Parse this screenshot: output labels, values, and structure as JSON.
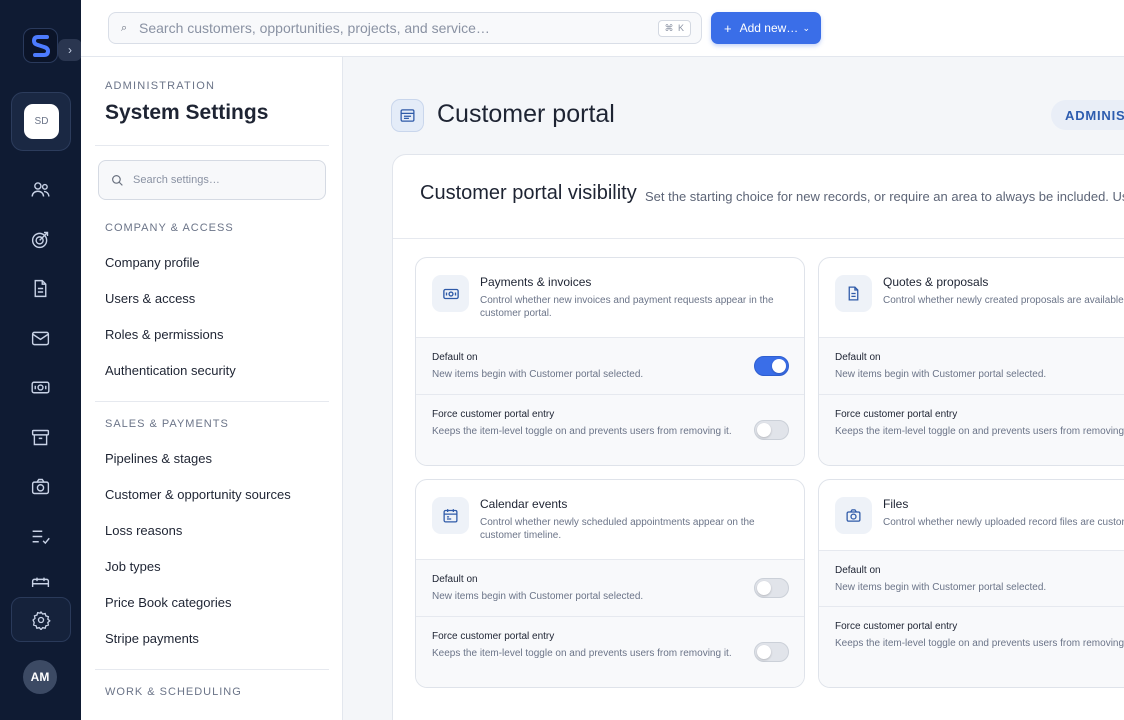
{
  "sidebar": {
    "logo_letter": "S",
    "workspace_initials": "SD",
    "user_initials": "AM",
    "nav_icons": [
      "people-icon",
      "target-icon",
      "document-icon",
      "mail-icon",
      "money-icon",
      "archive-icon",
      "camera-icon",
      "checklist-icon",
      "calendar-icon"
    ],
    "expand_label": "›"
  },
  "topbar": {
    "search_placeholder": "Search customers, opportunities, projects, and service…",
    "shortcut": "⌘ K",
    "add_label": "Add new…"
  },
  "settings": {
    "eyebrow": "ADMINISTRATION",
    "title": "System Settings",
    "search_placeholder": "Search settings…",
    "sections": [
      {
        "title": "COMPANY & ACCESS",
        "items": [
          "Company profile",
          "Users & access",
          "Roles & permissions",
          "Authentication security"
        ]
      },
      {
        "title": "SALES & PAYMENTS",
        "items": [
          "Pipelines & stages",
          "Customer & opportunity sources",
          "Loss reasons",
          "Job types",
          "Price Book categories",
          "Stripe payments"
        ]
      },
      {
        "title": "WORK & SCHEDULING",
        "items": []
      }
    ]
  },
  "page": {
    "title": "Customer portal",
    "badge": "ADMINIST",
    "panel_title": "Customer portal visibility",
    "panel_desc": "Set the starting choice for new records, or require an area to always be included. Users",
    "default_on_label": "Default on",
    "default_on_desc": "New items begin with Customer portal selected.",
    "force_label": "Force customer portal entry",
    "force_desc": "Keeps the item-level toggle on and prevents users from removing it.",
    "cards": [
      {
        "title": "Payments & invoices",
        "desc": "Control whether new invoices and payment requests appear in the customer portal.",
        "icon": "invoice-icon",
        "default_on": true,
        "force": false
      },
      {
        "title": "Quotes & proposals",
        "desc": "Control whether newly created proposals are available to customers.",
        "icon": "proposal-icon",
        "default_on": null,
        "force": null
      },
      {
        "title": "Calendar events",
        "desc": "Control whether newly scheduled appointments appear on the customer timeline.",
        "icon": "calendar-icon",
        "default_on": false,
        "force": false
      },
      {
        "title": "Files",
        "desc": "Control whether newly uploaded record files are customer visible.",
        "icon": "camera-icon",
        "default_on": null,
        "force": null
      }
    ]
  }
}
